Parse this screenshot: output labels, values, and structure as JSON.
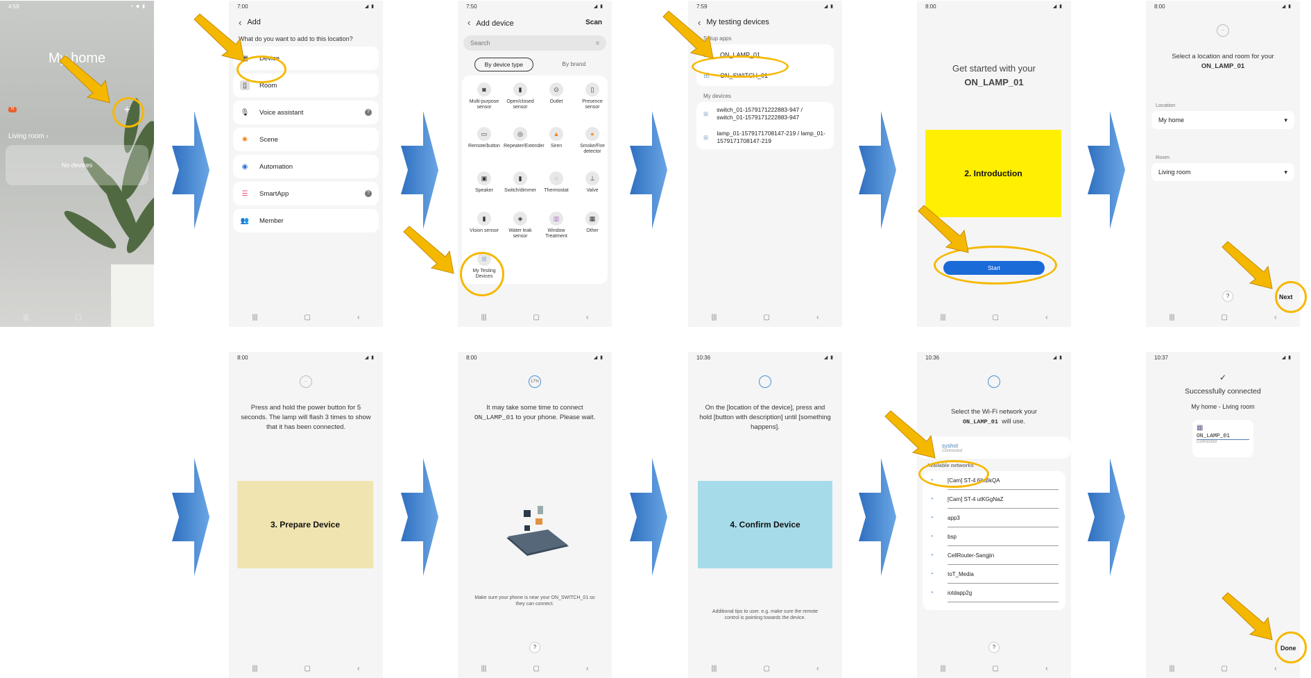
{
  "phone1": {
    "time": "4:59",
    "title": "My home",
    "plus": "+",
    "room": "Living room",
    "no_devices": "No devices",
    "badge": "N"
  },
  "phone2": {
    "time": "7:00",
    "title": "Add",
    "question": "What do you want to add to this location?",
    "items": [
      {
        "label": "Device"
      },
      {
        "label": "Room"
      },
      {
        "label": "Voice assistant",
        "help": "?"
      },
      {
        "label": "Scene"
      },
      {
        "label": "Automation"
      },
      {
        "label": "SmartApp",
        "help": "?"
      },
      {
        "label": "Member"
      }
    ]
  },
  "phone3": {
    "time": "7:50",
    "title": "Add device",
    "scan": "Scan",
    "search_placeholder": "Search",
    "tab1": "By device type",
    "tab2": "By brand",
    "items": [
      "Multi-purpose sensor",
      "Open/closed sensor",
      "Outlet",
      "Presence sensor",
      "Remote/button",
      "Repeater/Extender",
      "Siren",
      "Smoke/Fire detector",
      "Speaker",
      "Switch/dimmer",
      "Thermostat",
      "Valve",
      "Vision sensor",
      "Water leak sensor",
      "Window Treatment",
      "Other",
      "My Testing Devices"
    ]
  },
  "phone4": {
    "time": "7:59",
    "title": "My testing devices",
    "section1": "Setup apps",
    "apps": [
      "ON_LAMP_01",
      "ON_SWITCH_01"
    ],
    "section2": "My devices",
    "devices": [
      "switch_01-1579171222883-947 / switch_01-1579171222883-947",
      "lamp_01-1579171708147-219 / lamp_01-1579171708147-219"
    ]
  },
  "phone5": {
    "time": "8:00",
    "line1": "Get started with your",
    "device": "ON_LAMP_01",
    "block": "2. Introduction",
    "start": "Start",
    "block_color": "#ffef00"
  },
  "phone6": {
    "time": "8:00",
    "line1": "Select a location and room for your",
    "device": "ON_LAMP_01",
    "location_label": "Location",
    "location": "My home",
    "room_label": "Room",
    "room": "Living room",
    "help": "?",
    "next": "Next"
  },
  "phone7": {
    "time": "8:00",
    "text": "Press and hold the power button for 5 seconds. The lamp will flash 3 times to show that it has been connected.",
    "block": "3. Prepare Device",
    "block_color": "#f0e4b0"
  },
  "phone8": {
    "time": "8:00",
    "progress": "17%",
    "text1": "It may take some time to connect",
    "device": "ON_LAMP_01",
    "text2": "to your phone. Please wait.",
    "tip": "Make sure your phone is near your ON_SWITCH_01 so they can connect.",
    "help": "?"
  },
  "phone9": {
    "time": "10:36",
    "text": "On the [location of the device], press and hold [button with description] until [something happens].",
    "block": "4. Confirm Device",
    "block_color": "#a6dcea",
    "tip": "Additional tips to user. e.g. make sure the remote control is pointing towards the device."
  },
  "phone10": {
    "time": "10:36",
    "text1": "Select the Wi-Fi network your",
    "device": "ON_LAMP_01",
    "text2": "will use.",
    "connected_name": "syshot",
    "connected_status": "Connected",
    "available": "Available networks",
    "networks": [
      "[Cam] ST-4 6ilxBkQA",
      "[Cam] ST-4 utKGgNaZ",
      "app3",
      "bsp",
      "CellRouter-Sangjin",
      "IoT_Media",
      "iotdapp2g"
    ],
    "help": "?"
  },
  "phone11": {
    "time": "10:37",
    "title": "Successfully connected",
    "subtitle": "My home - Living room",
    "device": "ON_LAMP_01",
    "status": "Connected",
    "done": "Done"
  },
  "colors": {
    "accent": "#f5b800",
    "arrow": "#4a90d9",
    "button": "#1a6ad8"
  }
}
